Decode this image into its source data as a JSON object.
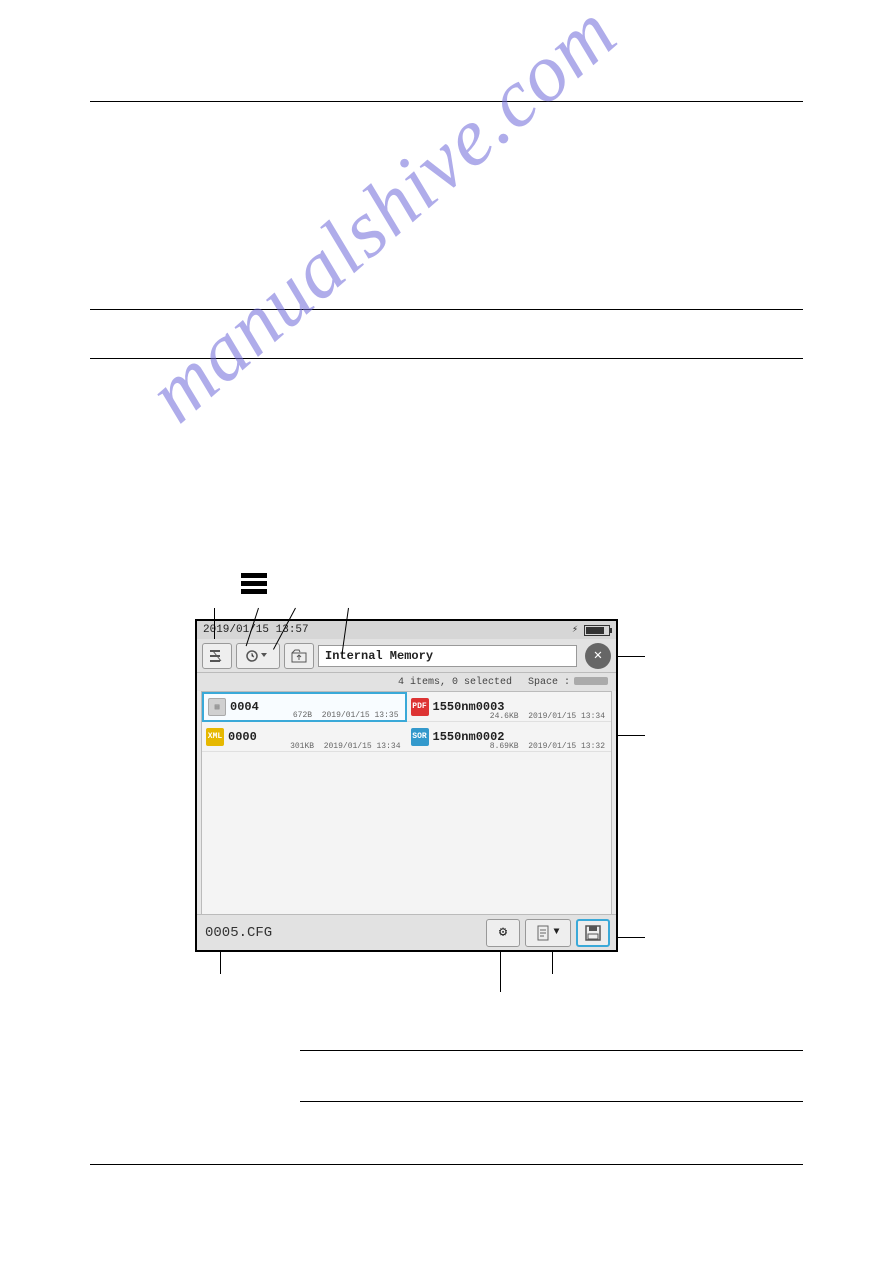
{
  "page": {
    "hr_positions": [
      101,
      309,
      358,
      1050,
      1101,
      1164
    ]
  },
  "watermark": "manualshive.com",
  "device": {
    "datetime": "2019/01/15 13:57",
    "path": "Internal Memory",
    "info": {
      "items": "4 items, 0 selected",
      "space_label": "Space :"
    },
    "files": [
      {
        "name": "0004",
        "type": "cfg",
        "size": "672B",
        "date": "2019/01/15 13:35",
        "selected": true
      },
      {
        "name": "1550nm0003",
        "type": "pdf",
        "size": "24.6KB",
        "date": "2019/01/15 13:34",
        "selected": false
      },
      {
        "name": "0000",
        "type": "xml",
        "size": "301KB",
        "date": "2019/01/15 13:34",
        "selected": false
      },
      {
        "name": "1550nm0002",
        "type": "sor",
        "size": "8.69KB",
        "date": "2019/01/15 13:32",
        "selected": false
      }
    ],
    "filename": "0005.CFG"
  }
}
